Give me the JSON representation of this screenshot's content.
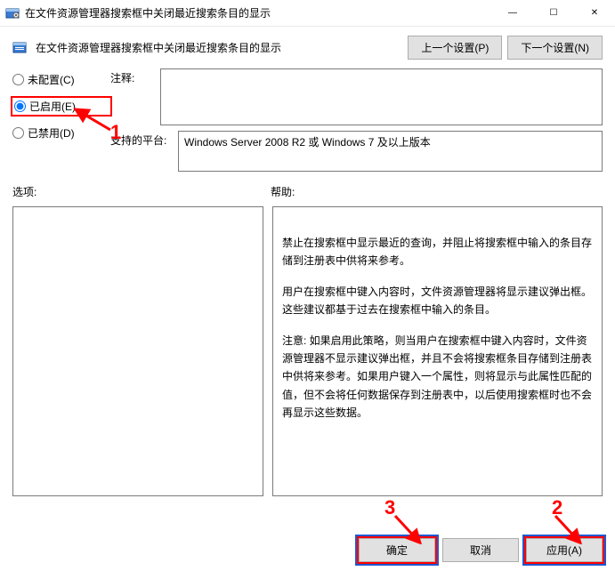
{
  "window": {
    "title": "在文件资源管理器搜索框中关闭最近搜索条目的显示",
    "min": "—",
    "max": "☐",
    "close": "✕"
  },
  "header": {
    "policy_title": "在文件资源管理器搜索框中关闭最近搜索条目的显示",
    "prev_btn": "上一个设置(P)",
    "next_btn": "下一个设置(N)"
  },
  "radios": {
    "not_configured": "未配置(C)",
    "enabled": "已启用(E)",
    "disabled": "已禁用(D)"
  },
  "labels": {
    "comment": "注释:",
    "supported": "支持的平台:",
    "options": "选项:",
    "help": "帮助:"
  },
  "fields": {
    "comment_value": "",
    "supported_value": "Windows Server 2008 R2 或 Windows 7 及以上版本"
  },
  "help": {
    "p1": "禁止在搜索框中显示最近的查询，并阻止将搜索框中输入的条目存储到注册表中供将来参考。",
    "p2": "用户在搜索框中键入内容时，文件资源管理器将显示建议弹出框。 这些建议都基于过去在搜索框中输入的条目。",
    "p3": "注意: 如果启用此策略，则当用户在搜索框中键入内容时，文件资源管理器不显示建议弹出框，并且不会将搜索框条目存储到注册表中供将来参考。如果用户键入一个属性，则将显示与此属性匹配的值，但不会将任何数据保存到注册表中，以后使用搜索框时也不会再显示这些数据。"
  },
  "footer": {
    "ok": "确定",
    "cancel": "取消",
    "apply": "应用(A)"
  },
  "annotations": {
    "n1": "1",
    "n2": "2",
    "n3": "3"
  }
}
